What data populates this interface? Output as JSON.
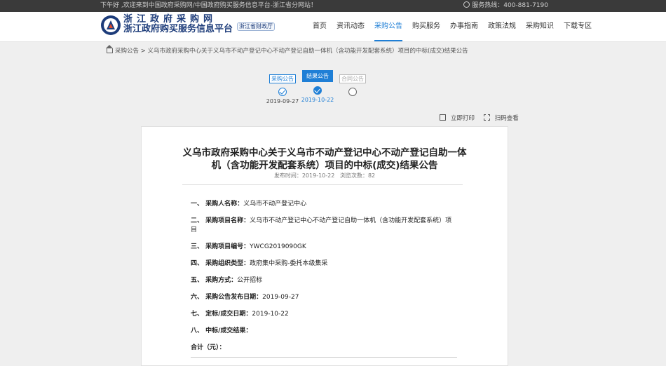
{
  "topbar": {
    "welcome": "下午好 ,欢迎来到中国政府采购网/中国政府购买服务信息平台-浙江省分网站！",
    "hotline": "服务热线：400-881-7190"
  },
  "header": {
    "title_line1": "浙江政府采购网",
    "title_line2": "浙江政府购买服务信息平台",
    "region_badge": "浙江省财政厅",
    "nav": [
      "首页",
      "资讯动态",
      "采购公告",
      "购买服务",
      "办事指南",
      "政策法规",
      "采购知识",
      "下载专区"
    ],
    "active_nav_index": 2
  },
  "breadcrumb": {
    "root": "采购公告",
    "separator": ">",
    "current": "义乌市政府采购中心关于义乌市不动产登记中心不动产登记自助一体机（含功能开发配套系统）项目的中标(成交)结果公告"
  },
  "steps": [
    {
      "label": "采购公告",
      "date": "2019-09-27",
      "state": "done"
    },
    {
      "label": "结果公告",
      "date": "2019-10-22",
      "state": "current"
    },
    {
      "label": "合同公告",
      "date": "",
      "state": "pending"
    }
  ],
  "tools": {
    "print": "立即打印",
    "scan": "扫码查看"
  },
  "document": {
    "title": "义乌市政府采购中心关于义乌市不动产登记中心不动产登记自助一体机（含功能开发配套系统）项目的中标(成交)结果公告",
    "publish_label": "发布时间：",
    "publish_date": "2019-10-22",
    "views_label": "浏览次数：",
    "views": "82",
    "fields": [
      {
        "key": "一、 采购人名称：",
        "value": "义乌市不动产登记中心"
      },
      {
        "key": "二、 采购项目名称：",
        "value": "义乌市不动产登记中心不动产登记自助一体机（含功能开发配套系统）项目"
      },
      {
        "key": "三、 采购项目编号：",
        "value": "YWCG2019090GK"
      },
      {
        "key": "四、 采购组织类型：",
        "value": "政府集中采购-委托本级集采"
      },
      {
        "key": "五、 采购方式：",
        "value": "公开招标"
      },
      {
        "key": "六、 采购公告发布日期：",
        "value": "2019-09-27"
      },
      {
        "key": "七、 定标/成交日期：",
        "value": "2019-10-22"
      },
      {
        "key": "八、 中标/成交结果：",
        "value": ""
      },
      {
        "key": "合计（元）：",
        "value": ""
      }
    ]
  },
  "colors": {
    "accent": "#1f7fd6",
    "topbar_bg": "#3a3a3a",
    "brand_text": "#1d3c7a"
  }
}
